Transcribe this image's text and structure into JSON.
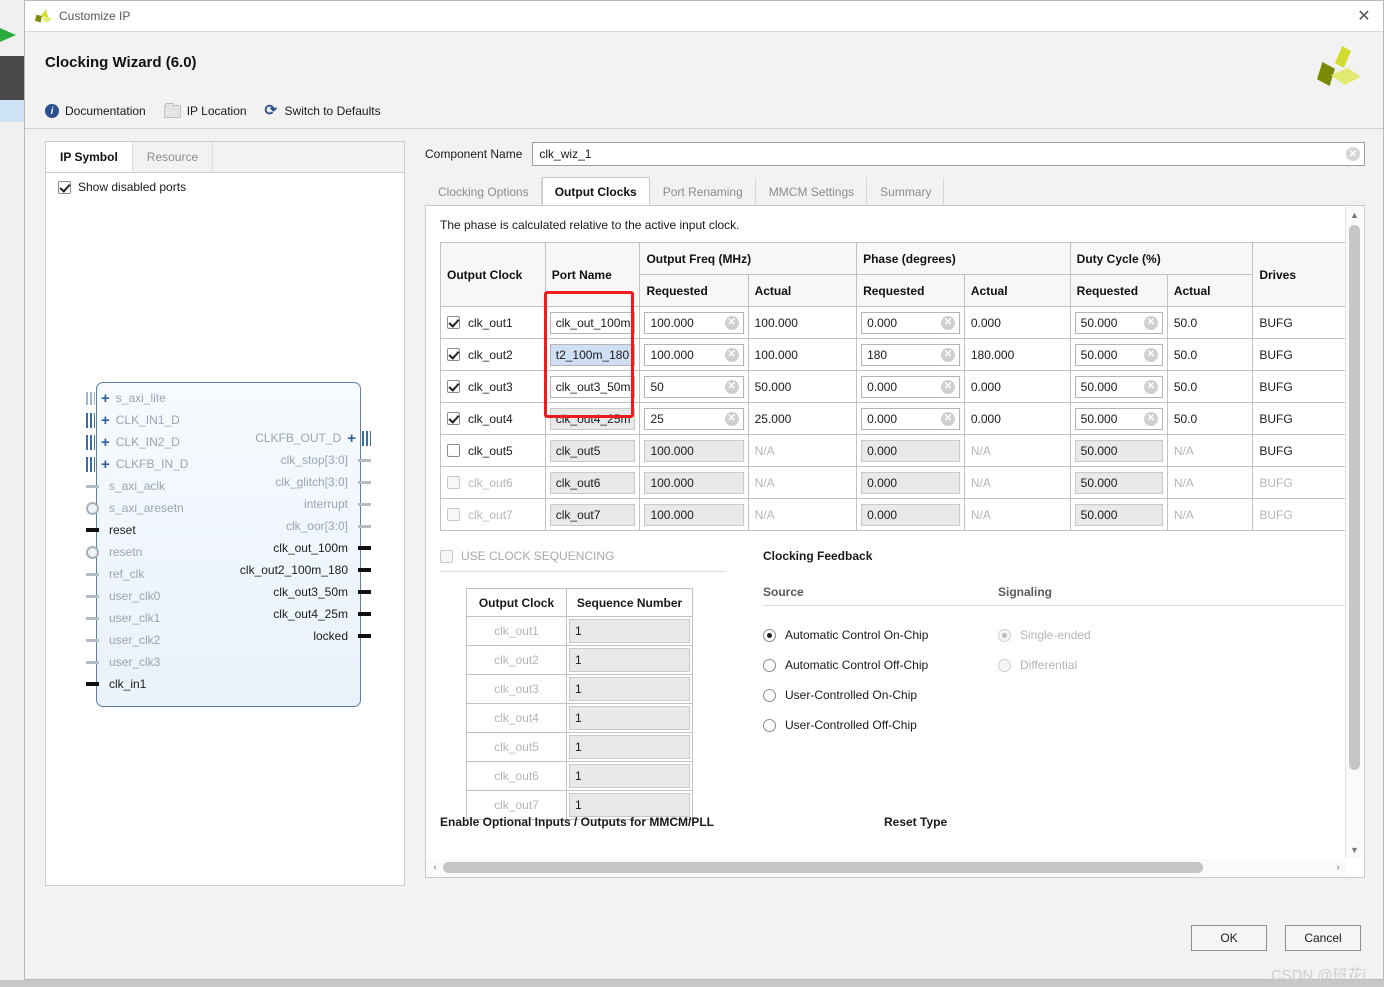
{
  "titlebar": {
    "title": "Customize IP",
    "close": "✕"
  },
  "header": {
    "product_title": "Clocking Wizard (6.0)"
  },
  "toolbar": {
    "documentation": "Documentation",
    "ip_location": "IP Location",
    "switch_defaults": "Switch to Defaults"
  },
  "left_panel": {
    "tabs": [
      {
        "label": "IP Symbol",
        "active": true
      },
      {
        "label": "Resource",
        "active": false
      }
    ],
    "show_disabled_ports": "Show disabled ports",
    "symbol": {
      "left_ports": [
        {
          "name": "s_axi_lite",
          "connector": "busdot",
          "plus": true,
          "enabled": false
        },
        {
          "name": "CLK_IN1_D",
          "connector": "bus",
          "plus": true,
          "enabled": false
        },
        {
          "name": "CLK_IN2_D",
          "connector": "bus",
          "plus": true,
          "enabled": false
        },
        {
          "name": "CLKFB_IN_D",
          "connector": "bus",
          "plus": true,
          "enabled": false
        },
        {
          "name": "s_axi_aclk",
          "connector": "stub",
          "plus": false,
          "enabled": false
        },
        {
          "name": "s_axi_aresetn",
          "connector": "bubble",
          "plus": false,
          "enabled": false
        },
        {
          "name": "reset",
          "connector": "stub",
          "plus": false,
          "enabled": true
        },
        {
          "name": "resetn",
          "connector": "bubble",
          "plus": false,
          "enabled": false
        },
        {
          "name": "ref_clk",
          "connector": "stub",
          "plus": false,
          "enabled": false
        },
        {
          "name": "user_clk0",
          "connector": "stub",
          "plus": false,
          "enabled": false
        },
        {
          "name": "user_clk1",
          "connector": "stub",
          "plus": false,
          "enabled": false
        },
        {
          "name": "user_clk2",
          "connector": "stub",
          "plus": false,
          "enabled": false
        },
        {
          "name": "user_clk3",
          "connector": "stub",
          "plus": false,
          "enabled": false
        },
        {
          "name": "clk_in1",
          "connector": "stub",
          "plus": false,
          "enabled": true
        }
      ],
      "right_ports": [
        {
          "name": "CLKFB_OUT_D",
          "connector": "bus",
          "plus": true,
          "enabled": false
        },
        {
          "name": "clk_stop[3:0]",
          "connector": "stub",
          "plus": false,
          "enabled": false
        },
        {
          "name": "clk_glitch[3:0]",
          "connector": "stub",
          "plus": false,
          "enabled": false
        },
        {
          "name": "interrupt",
          "connector": "stub",
          "plus": false,
          "enabled": false
        },
        {
          "name": "clk_oor[3:0]",
          "connector": "stub",
          "plus": false,
          "enabled": false
        },
        {
          "name": "clk_out_100m",
          "connector": "stub",
          "plus": false,
          "enabled": true
        },
        {
          "name": "clk_out2_100m_180",
          "connector": "stub",
          "plus": false,
          "enabled": true
        },
        {
          "name": "clk_out3_50m",
          "connector": "stub",
          "plus": false,
          "enabled": true
        },
        {
          "name": "clk_out4_25m",
          "connector": "stub",
          "plus": false,
          "enabled": true
        },
        {
          "name": "locked",
          "connector": "stub",
          "plus": false,
          "enabled": true
        }
      ]
    }
  },
  "main": {
    "component_name_label": "Component Name",
    "component_name_value": "clk_wiz_1",
    "tabs": [
      {
        "label": "Clocking Options",
        "active": false
      },
      {
        "label": "Output Clocks",
        "active": true
      },
      {
        "label": "Port Renaming",
        "active": false
      },
      {
        "label": "MMCM Settings",
        "active": false
      },
      {
        "label": "Summary",
        "active": false
      }
    ],
    "note": "The phase is calculated relative to the active input clock.",
    "table": {
      "group_headers": {
        "output_clock": "Output Clock",
        "port_name": "Port Name",
        "output_freq": "Output Freq (MHz)",
        "phase": "Phase (degrees)",
        "duty_cycle": "Duty Cycle (%)",
        "drives": "Drives"
      },
      "sub_headers": {
        "requested": "Requested",
        "actual": "Actual"
      },
      "rows": [
        {
          "clock": "clk_out1",
          "checked": true,
          "enabled": true,
          "port": "clk_out_100m",
          "port_selected": false,
          "freq_req": "100.000",
          "freq_act": "100.000",
          "phase_req": "0.000",
          "phase_act": "0.000",
          "duty_req": "50.000",
          "duty_act": "50.0",
          "drives": "BUFG"
        },
        {
          "clock": "clk_out2",
          "checked": true,
          "enabled": true,
          "port": "t2_100m_180",
          "port_selected": true,
          "freq_req": "100.000",
          "freq_act": "100.000",
          "phase_req": "180",
          "phase_act": "180.000",
          "duty_req": "50.000",
          "duty_act": "50.0",
          "drives": "BUFG"
        },
        {
          "clock": "clk_out3",
          "checked": true,
          "enabled": true,
          "port": "clk_out3_50m",
          "port_selected": false,
          "freq_req": "50",
          "freq_act": "50.000",
          "phase_req": "0.000",
          "phase_act": "0.000",
          "duty_req": "50.000",
          "duty_act": "50.0",
          "drives": "BUFG"
        },
        {
          "clock": "clk_out4",
          "checked": true,
          "enabled": true,
          "port": "clk_out4_25m",
          "port_selected": false,
          "freq_req": "25",
          "freq_act": "25.000",
          "phase_req": "0.000",
          "phase_act": "0.000",
          "duty_req": "50.000",
          "duty_act": "50.0",
          "drives": "BUFG"
        },
        {
          "clock": "clk_out5",
          "checked": false,
          "enabled": true,
          "port": "clk_out5",
          "port_selected": false,
          "freq_req": "100.000",
          "freq_act": "N/A",
          "phase_req": "0.000",
          "phase_act": "N/A",
          "duty_req": "50.000",
          "duty_act": "N/A",
          "drives": "BUFG"
        },
        {
          "clock": "clk_out6",
          "checked": false,
          "enabled": false,
          "port": "clk_out6",
          "port_selected": false,
          "freq_req": "100.000",
          "freq_act": "N/A",
          "phase_req": "0.000",
          "phase_act": "N/A",
          "duty_req": "50.000",
          "duty_act": "N/A",
          "drives": "BUFG"
        },
        {
          "clock": "clk_out7",
          "checked": false,
          "enabled": false,
          "port": "clk_out7",
          "port_selected": false,
          "freq_req": "100.000",
          "freq_act": "N/A",
          "phase_req": "0.000",
          "phase_act": "N/A",
          "duty_req": "50.000",
          "duty_act": "N/A",
          "drives": "BUFG"
        }
      ]
    },
    "use_clock_sequencing": {
      "label": "USE CLOCK SEQUENCING",
      "checked": false,
      "enabled": false
    },
    "sequence_table": {
      "headers": {
        "output_clock": "Output Clock",
        "sequence_number": "Sequence Number"
      },
      "rows": [
        {
          "clock": "clk_out1",
          "seq": "1"
        },
        {
          "clock": "clk_out2",
          "seq": "1"
        },
        {
          "clock": "clk_out3",
          "seq": "1"
        },
        {
          "clock": "clk_out4",
          "seq": "1"
        },
        {
          "clock": "clk_out5",
          "seq": "1"
        },
        {
          "clock": "clk_out6",
          "seq": "1"
        },
        {
          "clock": "clk_out7",
          "seq": "1"
        }
      ]
    },
    "clocking_feedback": {
      "title": "Clocking Feedback",
      "source_label": "Source",
      "signaling_label": "Signaling",
      "source_options": [
        {
          "label": "Automatic Control On-Chip",
          "selected": true,
          "enabled": true
        },
        {
          "label": "Automatic Control Off-Chip",
          "selected": false,
          "enabled": true
        },
        {
          "label": "User-Controlled On-Chip",
          "selected": false,
          "enabled": true
        },
        {
          "label": "User-Controlled Off-Chip",
          "selected": false,
          "enabled": true
        }
      ],
      "signaling_options": [
        {
          "label": "Single-ended",
          "selected": true,
          "enabled": false
        },
        {
          "label": "Differential",
          "selected": false,
          "enabled": false
        }
      ]
    },
    "bottom_sections": {
      "enable_optional": "Enable Optional Inputs / Outputs for MMCM/PLL",
      "reset_type": "Reset Type"
    }
  },
  "footer": {
    "ok": "OK",
    "cancel": "Cancel",
    "watermark": "CSDN @班花i"
  }
}
